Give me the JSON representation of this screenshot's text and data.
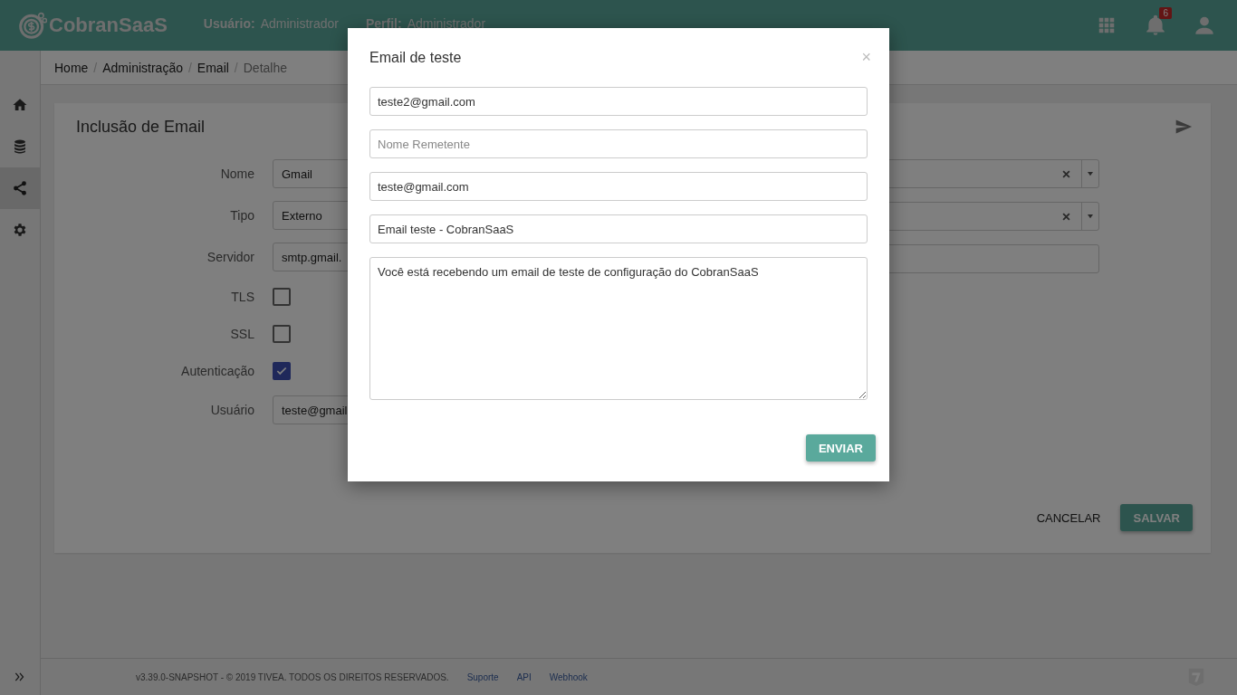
{
  "header": {
    "logo": "CobranSaaS",
    "user_label": "Usuário:",
    "user_value": "Administrador",
    "profile_label": "Perfil:",
    "profile_value": "Administrador",
    "notification_count": "6"
  },
  "sidebar": {
    "items": [
      {
        "kind": "home",
        "selected": false
      },
      {
        "kind": "database",
        "selected": false
      },
      {
        "kind": "share",
        "selected": true
      },
      {
        "kind": "settings",
        "selected": false
      }
    ]
  },
  "breadcrumb": [
    {
      "label": "Home",
      "current": false
    },
    {
      "separator": "/",
      "label": "Administração",
      "current": false
    },
    {
      "separator": "/",
      "label": "Email",
      "current": false
    },
    {
      "separator": "/",
      "label": "Detalhe",
      "current": true
    }
  ],
  "card": {
    "title": "Inclusão de Email",
    "fields": [
      {
        "kind": "input",
        "label": "Nome",
        "value": "Gmail"
      },
      {
        "kind": "input",
        "label": "Tipo",
        "value": "Externo"
      },
      {
        "kind": "input",
        "label": "Servidor",
        "value": "smtp.gmail."
      },
      {
        "kind": "checkbox",
        "label": "TLS",
        "checked": false
      },
      {
        "kind": "checkbox",
        "label": "SSL",
        "checked": false
      },
      {
        "kind": "checkbox",
        "label": "Autenticação",
        "checked": true
      },
      {
        "kind": "input",
        "label": "Usuário",
        "value": "teste@gmail"
      }
    ],
    "right_fields": [
      {
        "kind": "select"
      },
      {
        "kind": "select"
      },
      {
        "kind": "input"
      }
    ],
    "cancel_button": "CANCELAR",
    "save_button": "SALVAR"
  },
  "footer": {
    "copyright": "v3.39.0-SNAPSHOT - © 2019 TIVEA. TODOS OS DIREITOS RESERVADOS.",
    "links": [
      "Suporte",
      "API",
      "Webhook"
    ]
  },
  "modal": {
    "title": "Email de teste",
    "close": "×",
    "fields": [
      {
        "value": "teste2@gmail.com"
      },
      {
        "placeholder": "Nome Remetente"
      },
      {
        "value": "teste@gmail.com"
      },
      {
        "value": "Email teste - CobranSaaS"
      }
    ],
    "message": "Você está recebendo um email de teste de configuração do CobranSaaS",
    "send_button": "ENVIAR"
  }
}
